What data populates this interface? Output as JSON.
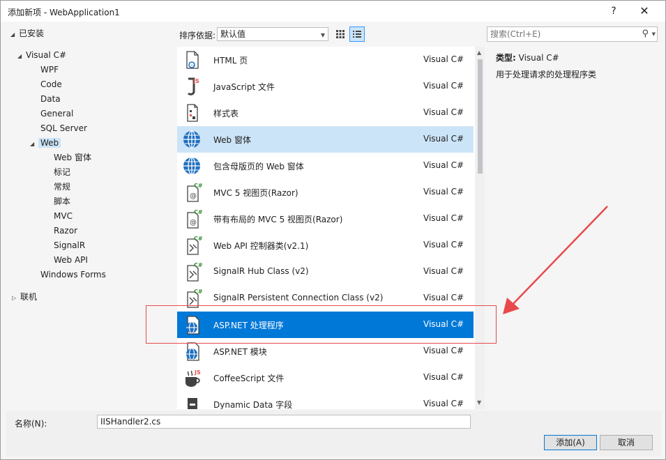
{
  "window": {
    "title": "添加新项 - WebApplication1",
    "help_label": "?",
    "close_label": "✕"
  },
  "tree": {
    "installed": "已安装",
    "visual_cs": "Visual C#",
    "items": [
      "WPF",
      "Code",
      "Data",
      "General",
      "SQL Server"
    ],
    "web": "Web",
    "web_children": [
      "Web 窗体",
      "标记",
      "常规",
      "脚本",
      "MVC",
      "Razor",
      "SignalR",
      "Web API"
    ],
    "windows_forms": "Windows Forms",
    "online": "联机"
  },
  "toolbar": {
    "sort_label": "排序依据:",
    "sort_value": "默认值",
    "search_placeholder": "搜索(Ctrl+E)"
  },
  "templates": [
    {
      "name": "HTML 页",
      "lang": "Visual C#",
      "icon": "html-page-icon"
    },
    {
      "name": "JavaScript 文件",
      "lang": "Visual C#",
      "icon": "javascript-file-icon"
    },
    {
      "name": "样式表",
      "lang": "Visual C#",
      "icon": "stylesheet-icon"
    },
    {
      "name": "Web 窗体",
      "lang": "Visual C#",
      "icon": "web-form-icon"
    },
    {
      "name": "包含母版页的 Web 窗体",
      "lang": "Visual C#",
      "icon": "web-form-master-icon"
    },
    {
      "name": "MVC 5 视图页(Razor)",
      "lang": "Visual C#",
      "icon": "mvc-view-icon"
    },
    {
      "name": "带有布局的 MVC 5 视图页(Razor)",
      "lang": "Visual C#",
      "icon": "mvc-layout-view-icon"
    },
    {
      "name": "Web API 控制器类(v2.1)",
      "lang": "Visual C#",
      "icon": "web-api-controller-icon"
    },
    {
      "name": "SignalR Hub Class (v2)",
      "lang": "Visual C#",
      "icon": "signalr-hub-icon"
    },
    {
      "name": "SignalR Persistent Connection Class (v2)",
      "lang": "Visual C#",
      "icon": "signalr-connection-icon"
    },
    {
      "name": "ASP.NET 处理程序",
      "lang": "Visual C#",
      "icon": "aspnet-handler-icon"
    },
    {
      "name": "ASP.NET 模块",
      "lang": "Visual C#",
      "icon": "aspnet-module-icon"
    },
    {
      "name": "CoffeeScript 文件",
      "lang": "Visual C#",
      "icon": "coffeescript-file-icon"
    },
    {
      "name": "Dynamic Data 字段",
      "lang": "Visual C#",
      "icon": "dynamic-data-icon"
    }
  ],
  "details": {
    "type_label": "类型:",
    "type_value": "Visual C#",
    "description": "用于处理请求的处理程序类"
  },
  "bottom": {
    "name_label": "名称(N):",
    "name_value": "IISHandler2.cs",
    "add_button": "添加(A)",
    "cancel_button": "取消"
  },
  "colors": {
    "selection": "#0078d7",
    "hover": "#cce4f7",
    "annotation_red": "#e8494b"
  }
}
